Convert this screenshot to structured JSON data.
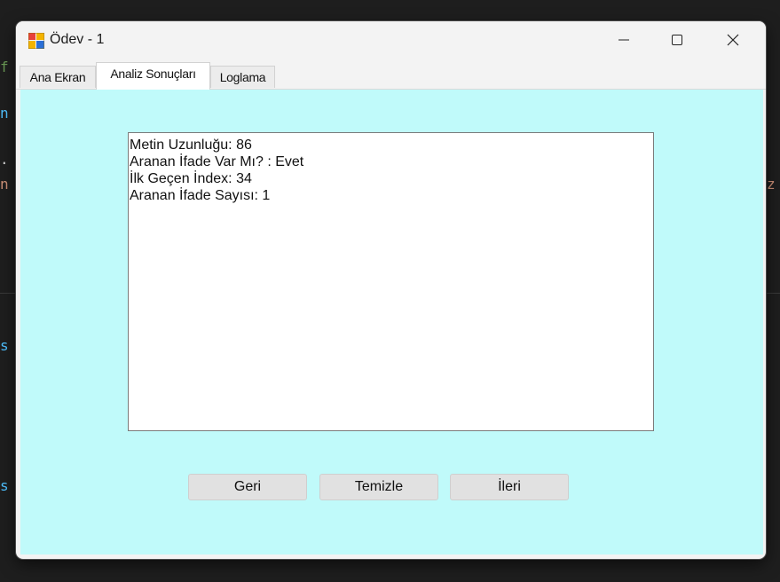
{
  "background": {
    "code_fragments": [
      {
        "text": "f",
        "color": "#6a9955"
      },
      {
        "text": "n",
        "color": "#4fc1ff"
      },
      {
        "text": ".",
        "color": "#d4d4d4"
      },
      {
        "text": "n",
        "color": "#ce9178"
      },
      {
        "text": "s",
        "color": "#4fc1ff"
      },
      {
        "text": "s",
        "color": "#4fc1ff"
      },
      {
        "text": "z",
        "color": "#ce9178"
      }
    ]
  },
  "window": {
    "title": "Ödev - 1",
    "app_icon": "windows-forms-app-icon",
    "controls": {
      "minimize": "minimize-icon",
      "maximize": "maximize-icon",
      "close": "close-icon"
    }
  },
  "tabs": [
    {
      "label": "Ana Ekran",
      "active": false
    },
    {
      "label": "Analiz Sonuçları",
      "active": true
    },
    {
      "label": "Loglama",
      "active": false
    }
  ],
  "results": {
    "lines": [
      "Metin Uzunluğu: 86",
      "Aranan İfade Var Mı? : Evet",
      "İlk Geçen İndex: 34",
      "Aranan İfade Sayısı: 1"
    ]
  },
  "buttons": {
    "back": "Geri",
    "clear": "Temizle",
    "next": "İleri"
  },
  "colors": {
    "tab_page_background": "#c0fafa",
    "ide_background": "#1e1e1e"
  }
}
